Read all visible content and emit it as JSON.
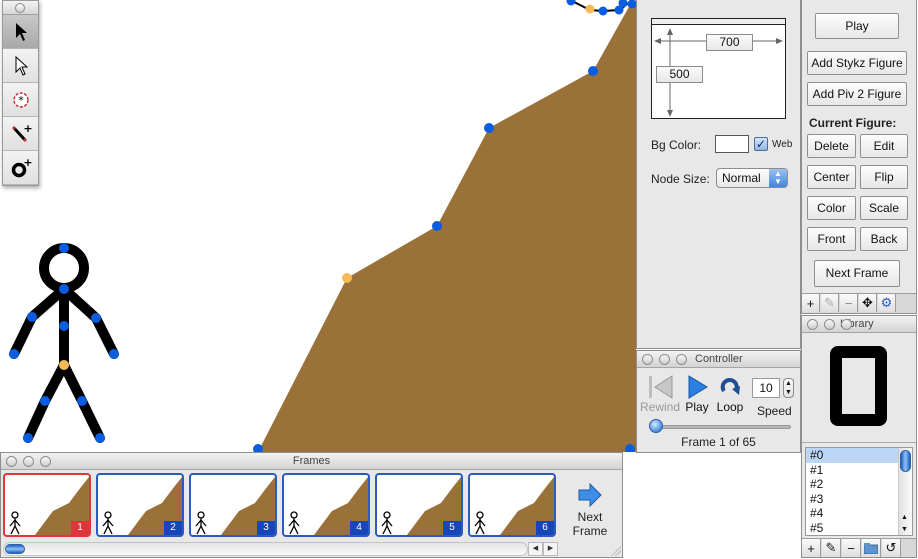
{
  "app": {
    "accent": "#1d5fc0",
    "node_color": "#0a5ce0",
    "pivot_color": "#f5b955",
    "ground_color": "#9a7139",
    "current_frame_color": "#e0353a"
  },
  "toolbar": {
    "tools": [
      {
        "name": "select-tool",
        "icon": "arrow-filled-icon",
        "active": true
      },
      {
        "name": "subselect-tool",
        "icon": "arrow-outline-icon",
        "active": false
      },
      {
        "name": "pivot-tool",
        "icon": "pivot-target-icon",
        "active": false
      },
      {
        "name": "add-line-tool",
        "icon": "add-line-icon",
        "active": false
      },
      {
        "name": "add-circle-tool",
        "icon": "add-circle-icon",
        "active": false
      }
    ]
  },
  "stage_settings": {
    "width_value": "700",
    "height_value": "500",
    "bg_color_label": "Bg Color:",
    "bg_color": "#ffffff",
    "web_label": "Web",
    "web_checked": true,
    "node_size_label": "Node Size:",
    "node_size_value": "Normal"
  },
  "controls": {
    "play": "Play",
    "add_stykz": "Add Stykz Figure",
    "add_piv2": "Add Piv 2 Figure",
    "current_figure_label": "Current Figure:",
    "delete": "Delete",
    "edit": "Edit",
    "center": "Center",
    "flip": "Flip",
    "color": "Color",
    "scale": "Scale",
    "front": "Front",
    "back": "Back",
    "next_frame": "Next Frame",
    "tools": [
      "+",
      "edit",
      "−",
      "move",
      "gear"
    ]
  },
  "library": {
    "title": "Library",
    "items": [
      "#0",
      "#1",
      "#2",
      "#3",
      "#4",
      "#5"
    ],
    "selected_index": 0,
    "tools": [
      "+",
      "edit",
      "−",
      "folder",
      "refresh"
    ]
  },
  "controller": {
    "title": "Controller",
    "rewind": "Rewind",
    "play": "Play",
    "loop": "Loop",
    "speed_label": "Speed",
    "speed_value": "10",
    "frame_status": "Frame 1 of 65",
    "position_fraction": 0.0
  },
  "frames": {
    "title": "Frames",
    "thumbnails": [
      {
        "number": "1",
        "current": true
      },
      {
        "number": "2",
        "current": false
      },
      {
        "number": "3",
        "current": false
      },
      {
        "number": "4",
        "current": false
      },
      {
        "number": "5",
        "current": false
      },
      {
        "number": "6",
        "current": false
      }
    ],
    "next_frame_line1": "Next",
    "next_frame_line2": "Frame"
  }
}
